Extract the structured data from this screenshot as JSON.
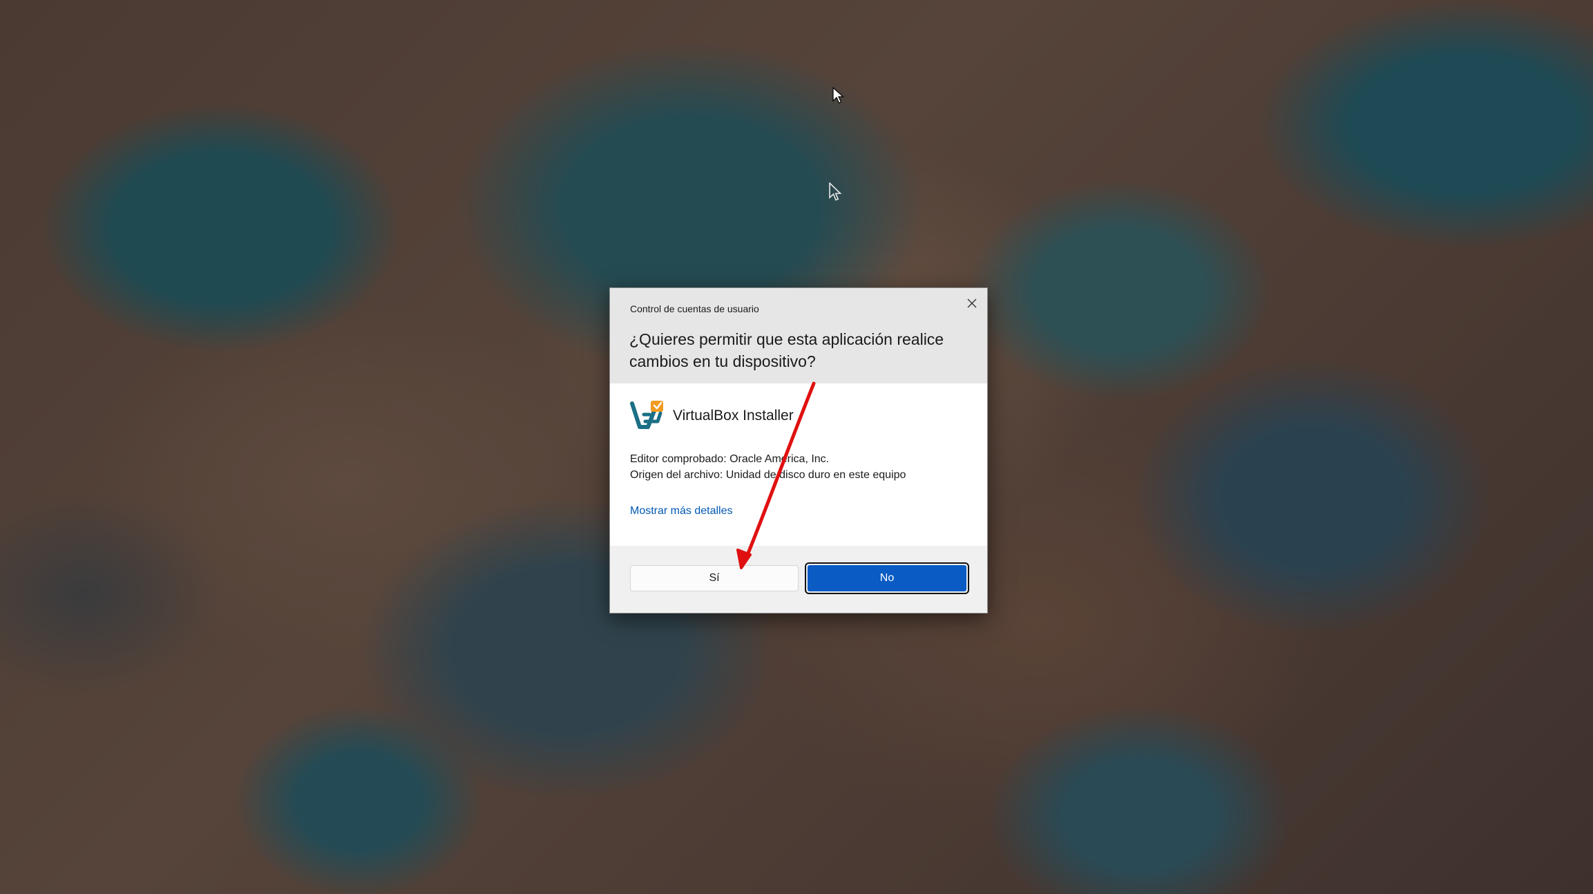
{
  "dialog": {
    "caption": "Control de cuentas de usuario",
    "question": "¿Quieres permitir que esta aplicación realice cambios en tu dispositivo?",
    "app_name": "VirtualBox Installer",
    "publisher": "Editor comprobado: Oracle America, Inc.",
    "origin": "Origen del archivo: Unidad de disco duro en este equipo",
    "more_details": "Mostrar más detalles",
    "yes_label": "Sí",
    "no_label": "No"
  },
  "icons": {
    "close": "close-icon",
    "app": "virtualbox-icon",
    "cursor": "mouse-pointer-icon",
    "annotation": "red-arrow-annotation"
  },
  "colors": {
    "primary_button": "#0a5bc4",
    "link": "#0059b3",
    "header_bg": "#e6e6e6",
    "annotation": "#e01010"
  }
}
